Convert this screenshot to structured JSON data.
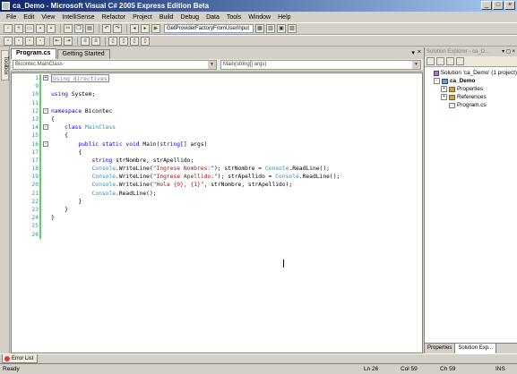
{
  "window": {
    "title": "ca_Demo - Microsoft Visual C# 2005 Express Edition Beta",
    "minimize": "_",
    "maximize": "□",
    "close": "×"
  },
  "menu": [
    "File",
    "Edit",
    "View",
    "IntelliSense",
    "Refactor",
    "Project",
    "Build",
    "Debug",
    "Data",
    "Tools",
    "Window",
    "Help"
  ],
  "toolbar": {
    "find_combo": "GetProviderFactoryFromUserInput",
    "icons": [
      "new-project-icon",
      "add-item-icon",
      "open-icon",
      "save-icon",
      "save-all-icon",
      "cut-icon",
      "copy-icon",
      "paste-icon",
      "undo-icon",
      "redo-icon",
      "navigate-back-icon",
      "navigate-forward-icon",
      "start-debug-icon",
      "solution-explorer-icon",
      "properties-icon",
      "object-browser-icon",
      "toolbox-icon"
    ]
  },
  "toolbox": {
    "label": "Toolbox"
  },
  "tabs": [
    {
      "label": "Program.cs",
      "active": true
    },
    {
      "label": "Getting Started",
      "active": false
    }
  ],
  "tab_controls": {
    "dropdown": "▾",
    "close": "×"
  },
  "navbar": {
    "class_combo": "Bicontec.MainClass",
    "member_combo": "Main(string[] args)"
  },
  "code_lines": [
    {
      "num": "1",
      "fold": "+",
      "segments": [
        {
          "c": "region",
          "t": "Using directives"
        }
      ]
    },
    {
      "num": "9",
      "fold": "",
      "segments": []
    },
    {
      "num": "10",
      "fold": "",
      "segments": [
        {
          "c": "kw",
          "t": "using"
        },
        {
          "c": "txt",
          "t": " System;"
        }
      ]
    },
    {
      "num": "11",
      "fold": "",
      "segments": []
    },
    {
      "num": "12",
      "fold": "-",
      "segments": [
        {
          "c": "kw",
          "t": "namespace"
        },
        {
          "c": "txt",
          "t": " Bicontec"
        }
      ]
    },
    {
      "num": "13",
      "fold": "",
      "segments": [
        {
          "c": "txt",
          "t": "{"
        }
      ]
    },
    {
      "num": "14",
      "fold": "-",
      "segments": [
        {
          "c": "txt",
          "t": "    "
        },
        {
          "c": "kw",
          "t": "class"
        },
        {
          "c": "txt",
          "t": " "
        },
        {
          "c": "ty",
          "t": "MainClass"
        }
      ]
    },
    {
      "num": "15",
      "fold": "",
      "segments": [
        {
          "c": "txt",
          "t": "    {"
        }
      ]
    },
    {
      "num": "16",
      "fold": "-",
      "segments": [
        {
          "c": "txt",
          "t": "        "
        },
        {
          "c": "kw",
          "t": "public static void"
        },
        {
          "c": "txt",
          "t": " Main("
        },
        {
          "c": "kw",
          "t": "string"
        },
        {
          "c": "txt",
          "t": "[] args)"
        }
      ]
    },
    {
      "num": "16b",
      "fold": "",
      "segments": [
        {
          "c": "txt",
          "t": "        {"
        }
      ]
    },
    {
      "num": "17",
      "fold": "",
      "segments": [
        {
          "c": "txt",
          "t": "            "
        },
        {
          "c": "kw",
          "t": "string"
        },
        {
          "c": "txt",
          "t": " strNombre, strApellido;"
        }
      ]
    },
    {
      "num": "18",
      "fold": "",
      "segments": [
        {
          "c": "txt",
          "t": "            "
        },
        {
          "c": "ty",
          "t": "Console"
        },
        {
          "c": "txt",
          "t": ".WriteLine("
        },
        {
          "c": "str",
          "t": "\"Ingrese Nombres:\""
        },
        {
          "c": "txt",
          "t": "); strNombre = "
        },
        {
          "c": "ty",
          "t": "Console"
        },
        {
          "c": "txt",
          "t": ".ReadLine();"
        }
      ]
    },
    {
      "num": "19",
      "fold": "",
      "segments": [
        {
          "c": "txt",
          "t": "            "
        },
        {
          "c": "ty",
          "t": "Console"
        },
        {
          "c": "txt",
          "t": ".WriteLine("
        },
        {
          "c": "str",
          "t": "\"Ingrese Apellido:\""
        },
        {
          "c": "txt",
          "t": "); strApellido = "
        },
        {
          "c": "ty",
          "t": "Console"
        },
        {
          "c": "txt",
          "t": ".ReadLine();"
        }
      ]
    },
    {
      "num": "20",
      "fold": "",
      "segments": [
        {
          "c": "txt",
          "t": "            "
        },
        {
          "c": "ty",
          "t": "Console"
        },
        {
          "c": "txt",
          "t": ".WriteLine("
        },
        {
          "c": "str",
          "t": "\"Hola {0}, {1}\""
        },
        {
          "c": "txt",
          "t": ", strNombre, strApellido);"
        }
      ]
    },
    {
      "num": "21",
      "fold": "",
      "segments": [
        {
          "c": "txt",
          "t": "            "
        },
        {
          "c": "ty",
          "t": "Console"
        },
        {
          "c": "txt",
          "t": ".ReadLine();"
        }
      ]
    },
    {
      "num": "22",
      "fold": "",
      "segments": [
        {
          "c": "txt",
          "t": "        }"
        }
      ]
    },
    {
      "num": "23",
      "fold": "",
      "segments": [
        {
          "c": "txt",
          "t": "    }"
        }
      ]
    },
    {
      "num": "24",
      "fold": "",
      "segments": [
        {
          "c": "txt",
          "t": "}"
        }
      ]
    },
    {
      "num": "25",
      "fold": "",
      "segments": []
    },
    {
      "num": "26",
      "fold": "",
      "segments": []
    }
  ],
  "solution_explorer": {
    "title": "Solution Explorer - ca_D...",
    "header_ctrls": "▾ ◻ ×",
    "items": [
      {
        "label": "Solution 'ca_Demo' (1 project)",
        "indent": 0,
        "expander": "",
        "icon": "sol",
        "bold": false
      },
      {
        "label": "ca_Demo",
        "indent": 1,
        "expander": "-",
        "icon": "proj",
        "bold": true
      },
      {
        "label": "Properties",
        "indent": 2,
        "expander": "+",
        "icon": "folder",
        "bold": false
      },
      {
        "label": "References",
        "indent": 2,
        "expander": "+",
        "icon": "folder",
        "bold": false
      },
      {
        "label": "Program.cs",
        "indent": 2,
        "expander": "",
        "icon": "file",
        "bold": false
      }
    ],
    "bottom_tabs": [
      {
        "label": "Properties",
        "active": false
      },
      {
        "label": "Solution Exp...",
        "active": true
      }
    ]
  },
  "error_list": {
    "label": "Error List"
  },
  "status": {
    "ready": "Ready",
    "ln": "Ln 26",
    "col": "Col 59",
    "ch": "Ch 59",
    "ins": "INS"
  }
}
